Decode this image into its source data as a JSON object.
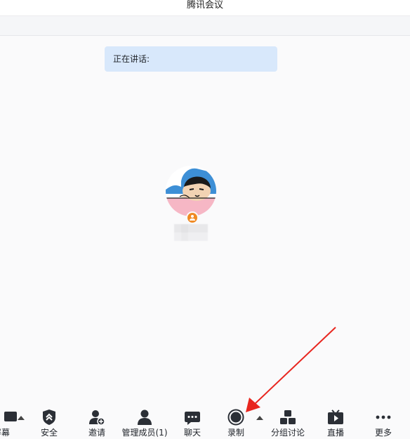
{
  "window": {
    "title": "腾讯会议"
  },
  "speaking": {
    "label": "正在讲话:"
  },
  "colors": {
    "accent": "#d8e8fb",
    "host_badge": "#f08a24",
    "annotation_arrow": "#e8261f"
  },
  "toolbar": {
    "items": [
      {
        "label": "屏幕",
        "icon": "share-screen-icon"
      },
      {
        "label": "安全",
        "icon": "shield-icon"
      },
      {
        "label": "邀请",
        "icon": "invite-user-icon"
      },
      {
        "label": "管理成员(1)",
        "icon": "members-icon"
      },
      {
        "label": "聊天",
        "icon": "chat-icon"
      },
      {
        "label": "录制",
        "icon": "record-icon"
      },
      {
        "label": "分组讨论",
        "icon": "breakout-rooms-icon"
      },
      {
        "label": "直播",
        "icon": "live-stream-icon"
      },
      {
        "label": "更多",
        "icon": "more-icon"
      }
    ]
  }
}
